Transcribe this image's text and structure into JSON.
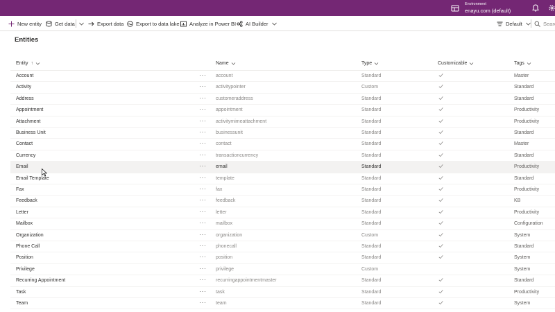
{
  "topbar": {
    "env_label": "Environment",
    "env_name": "enayu.com (default)"
  },
  "commands": {
    "new_entity": "New entity",
    "get_data": "Get data",
    "export_data": "Export data",
    "export_lake": "Export to data lake",
    "analyze_pbi": "Analyze in Power BI",
    "ai_builder": "AI Builder",
    "view": "Default",
    "search_placeholder": "Search"
  },
  "page": {
    "title": "Entities"
  },
  "columns": {
    "entity": "Entity",
    "entity_sort": "↑",
    "name": "Name",
    "type": "Type",
    "customizable": "Customizable",
    "tags": "Tags"
  },
  "rows": [
    {
      "entity": "Account",
      "name": "account",
      "type": "Standard",
      "customizable": true,
      "tags": "Master"
    },
    {
      "entity": "Activity",
      "name": "activitypointer",
      "type": "Custom",
      "customizable": true,
      "tags": "Standard"
    },
    {
      "entity": "Address",
      "name": "customeraddress",
      "type": "Standard",
      "customizable": true,
      "tags": "Standard"
    },
    {
      "entity": "Appointment",
      "name": "appointment",
      "type": "Standard",
      "customizable": true,
      "tags": "Productivity"
    },
    {
      "entity": "Attachment",
      "name": "activitymimeattachment",
      "type": "Standard",
      "customizable": true,
      "tags": "Productivity"
    },
    {
      "entity": "Business Unit",
      "name": "businessunit",
      "type": "Standard",
      "customizable": true,
      "tags": "Standard"
    },
    {
      "entity": "Contact",
      "name": "contact",
      "type": "Standard",
      "customizable": true,
      "tags": "Master"
    },
    {
      "entity": "Currency",
      "name": "transactioncurrency",
      "type": "Standard",
      "customizable": true,
      "tags": "Standard"
    },
    {
      "entity": "Email",
      "name": "email",
      "type": "Standard",
      "customizable": true,
      "tags": "Productivity"
    },
    {
      "entity": "Email Template",
      "name": "template",
      "type": "Standard",
      "customizable": true,
      "tags": "Standard"
    },
    {
      "entity": "Fax",
      "name": "fax",
      "type": "Standard",
      "customizable": true,
      "tags": "Productivity"
    },
    {
      "entity": "Feedback",
      "name": "feedback",
      "type": "Standard",
      "customizable": true,
      "tags": "KB"
    },
    {
      "entity": "Letter",
      "name": "letter",
      "type": "Standard",
      "customizable": true,
      "tags": "Productivity"
    },
    {
      "entity": "Mailbox",
      "name": "mailbox",
      "type": "Standard",
      "customizable": true,
      "tags": "Configuration"
    },
    {
      "entity": "Organization",
      "name": "organization",
      "type": "Custom",
      "customizable": true,
      "tags": "System"
    },
    {
      "entity": "Phone Call",
      "name": "phonecall",
      "type": "Standard",
      "customizable": true,
      "tags": "Standard"
    },
    {
      "entity": "Position",
      "name": "position",
      "type": "Standard",
      "customizable": true,
      "tags": "System"
    },
    {
      "entity": "Privilege",
      "name": "privilege",
      "type": "Custom",
      "customizable": false,
      "tags": "System"
    },
    {
      "entity": "Recurring Appointment",
      "name": "recurringappointmentmaster",
      "type": "Standard",
      "customizable": true,
      "tags": "Standard"
    },
    {
      "entity": "Task",
      "name": "task",
      "type": "Standard",
      "customizable": true,
      "tags": "Productivity"
    },
    {
      "entity": "Team",
      "name": "team",
      "type": "Standard",
      "customizable": true,
      "tags": "System"
    }
  ],
  "more_glyph": "···",
  "hovered_row": 8,
  "colors": {
    "accent": "#742774",
    "text": "#323130",
    "muted": "#8a8886"
  }
}
